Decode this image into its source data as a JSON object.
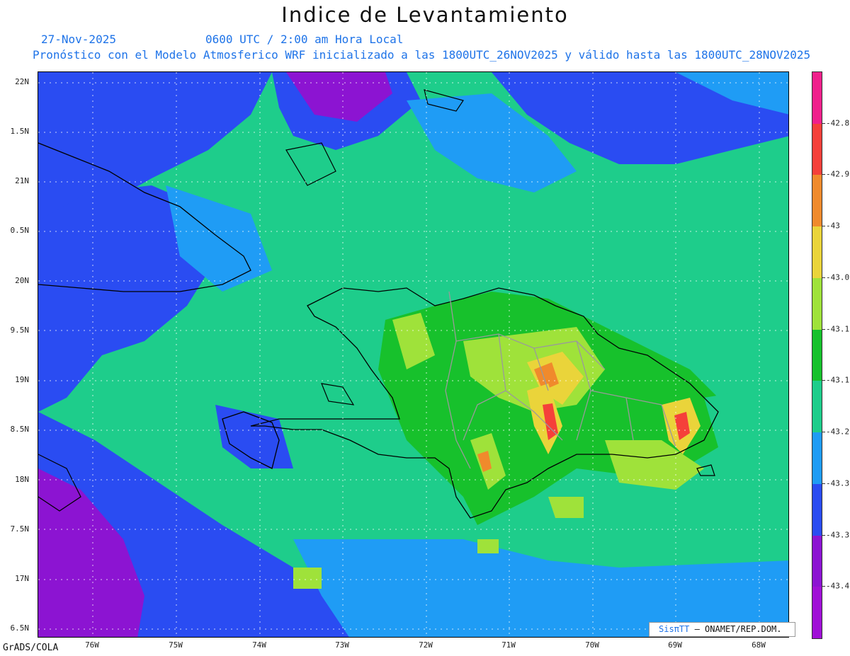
{
  "title": "Indice de Levantamiento",
  "date_label": "27-Nov-2025",
  "time_label": "0600 UTC / 2:00 am Hora Local",
  "model_note": "Pronóstico con el Modelo Atmosferico WRF inicializado a las 1800UTC_26NOV2025 y válido hasta las  1800UTC_28NOV2025",
  "credit": "GrADS/COLA",
  "sispi": {
    "brand": "SisπTT",
    "org": "– ONAMET/REP.DOM."
  },
  "map": {
    "lat_labels": [
      "22N",
      "1.5N",
      "21N",
      "0.5N",
      "20N",
      "9.5N",
      "19N",
      "8.5N",
      "18N",
      "7.5N",
      "17N",
      "6.5N"
    ],
    "lon_labels": [
      "76W",
      "75W",
      "74W",
      "73W",
      "72W",
      "71W",
      "70W",
      "69W",
      "68W"
    ],
    "colors": {
      "background": "#1ecd8b",
      "blue": "#2a4cf2",
      "light_blue": "#1f9cf5",
      "purple": "#8c14d2",
      "green": "#17c12c",
      "lime": "#9fe23a",
      "yellow": "#ead43a",
      "orange": "#f08a2c",
      "red": "#f5403a",
      "coast": "#000000",
      "provinces": "#9a9a9a",
      "grid": "#ffffff"
    }
  },
  "colorbar": {
    "labels": [
      "-42.8",
      "-42.9",
      "-43",
      "-43.0",
      "-43.1",
      "-43.1",
      "-43.2",
      "-43.3",
      "-43.3",
      "-43.4"
    ],
    "colors": [
      "#f0208c",
      "#f5403a",
      "#f08a2c",
      "#ead43a",
      "#9fe23a",
      "#17c12c",
      "#1ecd8b",
      "#1f9cf5",
      "#2a4cf2",
      "#8c14d2",
      "#a011d6"
    ]
  }
}
